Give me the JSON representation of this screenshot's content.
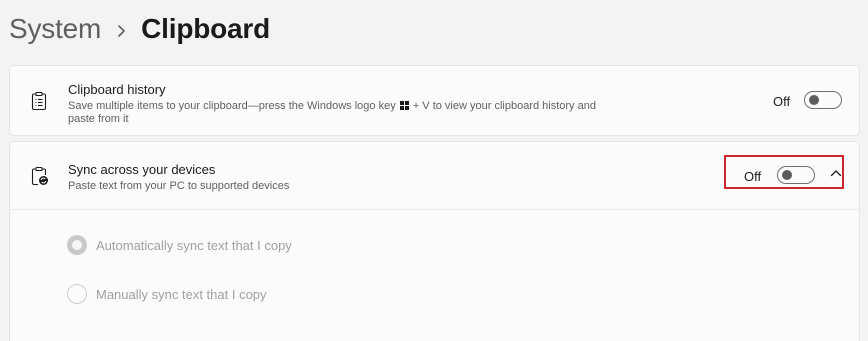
{
  "breadcrumb": {
    "parent": "System",
    "current": "Clipboard"
  },
  "clipboard_history": {
    "title": "Clipboard history",
    "desc_before_key": "Save multiple items to your clipboard—press the Windows logo key",
    "desc_after_key": "+ V to view your clipboard history and",
    "desc_line2": "paste from it",
    "toggle_label": "Off",
    "toggle_state": "off",
    "icon": "clipboard-list-icon"
  },
  "sync": {
    "title": "Sync across your devices",
    "desc": "Paste text from your PC to supported devices",
    "toggle_label": "Off",
    "toggle_state": "off",
    "icon": "clipboard-sync-icon",
    "expanded": true,
    "options": [
      {
        "label": "Automatically sync text that I copy",
        "selected": true,
        "enabled": false
      },
      {
        "label": "Manually sync text that I copy",
        "selected": false,
        "enabled": false
      }
    ]
  },
  "colors": {
    "background": "#f3f3f3",
    "card": "#fbfbfb",
    "highlight": "#c8282d",
    "disabled_text": "#a0a0a0"
  }
}
